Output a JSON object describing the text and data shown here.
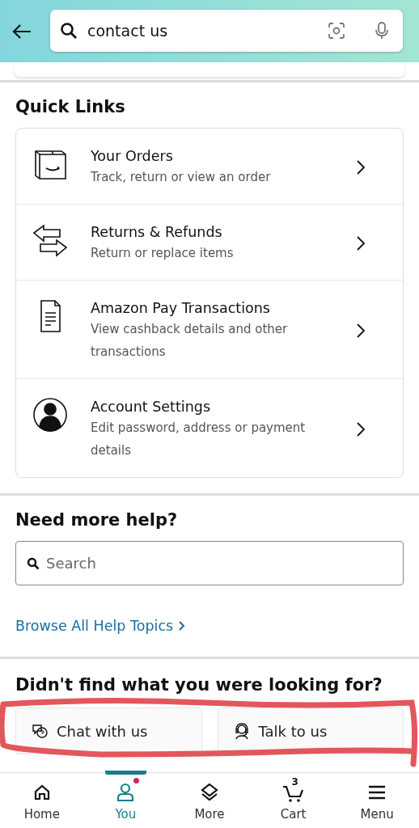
{
  "search_bar": {
    "value": "contact us"
  },
  "quick_links": {
    "title": "Quick Links",
    "items": [
      {
        "title": "Your Orders",
        "subtitle": "Track, return or view an order"
      },
      {
        "title": "Returns & Refunds",
        "subtitle": "Return or replace items"
      },
      {
        "title": "Amazon Pay Transactions",
        "subtitle": "View cashback details and other transactions"
      },
      {
        "title": "Account Settings",
        "subtitle": "Edit password, address or payment details"
      }
    ]
  },
  "help": {
    "title": "Need more help?",
    "search": {
      "placeholder": "Search"
    },
    "link": "Browse All Help Topics"
  },
  "contact": {
    "title": "Didn't find what you were looking for?",
    "buttons": [
      {
        "label": "Chat with us"
      },
      {
        "label": "Talk to us"
      }
    ]
  },
  "bottom_nav": [
    {
      "label": "Home",
      "selected": false,
      "dot": false
    },
    {
      "label": "You",
      "selected": true,
      "dot": true
    },
    {
      "label": "More",
      "selected": false,
      "dot": false
    },
    {
      "label": "Cart",
      "selected": false,
      "dot": false,
      "count": "3"
    },
    {
      "label": "Menu",
      "selected": false,
      "dot": false
    }
  ]
}
